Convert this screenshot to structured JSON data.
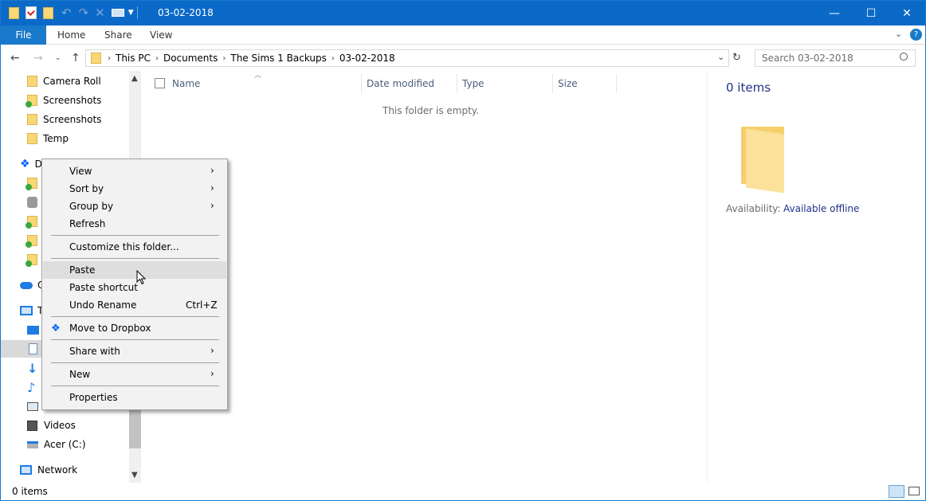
{
  "window": {
    "title": "03-02-2018",
    "minimize": "—",
    "maximize": "☐",
    "close": "✕"
  },
  "ribbon": {
    "file": "File",
    "tabs": [
      "Home",
      "Share",
      "View"
    ]
  },
  "address": {
    "crumbs": [
      "This PC",
      "Documents",
      "The Sims 1 Backups",
      "03-02-2018"
    ],
    "search_placeholder": "Search 03-02-2018"
  },
  "nav": {
    "items": [
      {
        "label": "Camera Roll",
        "icon": "folder-icon"
      },
      {
        "label": "Screenshots",
        "icon": "folder-synced-icon"
      },
      {
        "label": "Screenshots",
        "icon": "folder-icon"
      },
      {
        "label": "Temp",
        "icon": "folder-icon"
      },
      {
        "label": "D",
        "icon": "dropbox-icon"
      },
      {
        "label": "",
        "icon": "folder-synced-icon"
      },
      {
        "label": "",
        "icon": "camera-folder-icon"
      },
      {
        "label": "",
        "icon": "folder-synced-icon"
      },
      {
        "label": "",
        "icon": "folder-synced-icon"
      },
      {
        "label": "",
        "icon": "folder-synced-icon"
      },
      {
        "label": "O",
        "icon": "onedrive-icon"
      },
      {
        "label": "T",
        "icon": "this-pc-icon"
      },
      {
        "label": "",
        "icon": "desktop-icon"
      },
      {
        "label": "",
        "icon": "documents-icon"
      },
      {
        "label": "",
        "icon": "downloads-icon"
      },
      {
        "label": "",
        "icon": "music-icon"
      },
      {
        "label": "",
        "icon": "pictures-icon"
      },
      {
        "label": "Videos",
        "icon": "videos-icon"
      },
      {
        "label": "Acer (C:)",
        "icon": "drive-icon"
      },
      {
        "label": "Network",
        "icon": "network-icon"
      }
    ]
  },
  "columns": {
    "name": "Name",
    "date_modified": "Date modified",
    "type": "Type",
    "size": "Size"
  },
  "empty_text": "This folder is empty.",
  "details": {
    "items": "0 items",
    "availability_label": "Availability:",
    "availability_value": "Available offline"
  },
  "status": {
    "items": "0 items"
  },
  "context_menu": {
    "view": "View",
    "sort_by": "Sort by",
    "group_by": "Group by",
    "refresh": "Refresh",
    "customize": "Customize this folder...",
    "paste": "Paste",
    "paste_shortcut": "Paste shortcut",
    "undo_rename": "Undo Rename",
    "undo_shortcut": "Ctrl+Z",
    "move_to_dropbox": "Move to Dropbox",
    "share_with": "Share with",
    "new": "New",
    "properties": "Properties"
  },
  "colors": {
    "titlebar": "#0b6ac8",
    "file_tab": "#1979ca",
    "folder": "#f8d775",
    "hover": "#dedede",
    "details_count": "#1e3287"
  }
}
